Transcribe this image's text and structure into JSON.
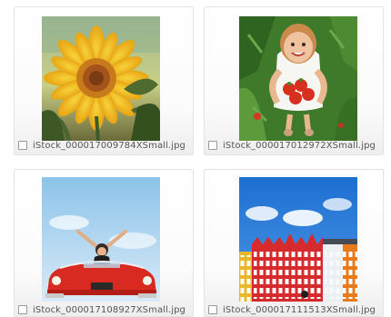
{
  "grid": {
    "items": [
      {
        "filename": "iStock_000017009784XSmall.jpg",
        "image": "sunflower-photo"
      },
      {
        "filename": "iStock_000017012972XSmall.jpg",
        "image": "girl-with-tomatoes-photo"
      },
      {
        "filename": "iStock_000017108927XSmall.jpg",
        "image": "woman-in-red-convertible-photo"
      },
      {
        "filename": "iStock_000017111513XSmall.jpg",
        "image": "colorful-houses-photo"
      }
    ]
  }
}
